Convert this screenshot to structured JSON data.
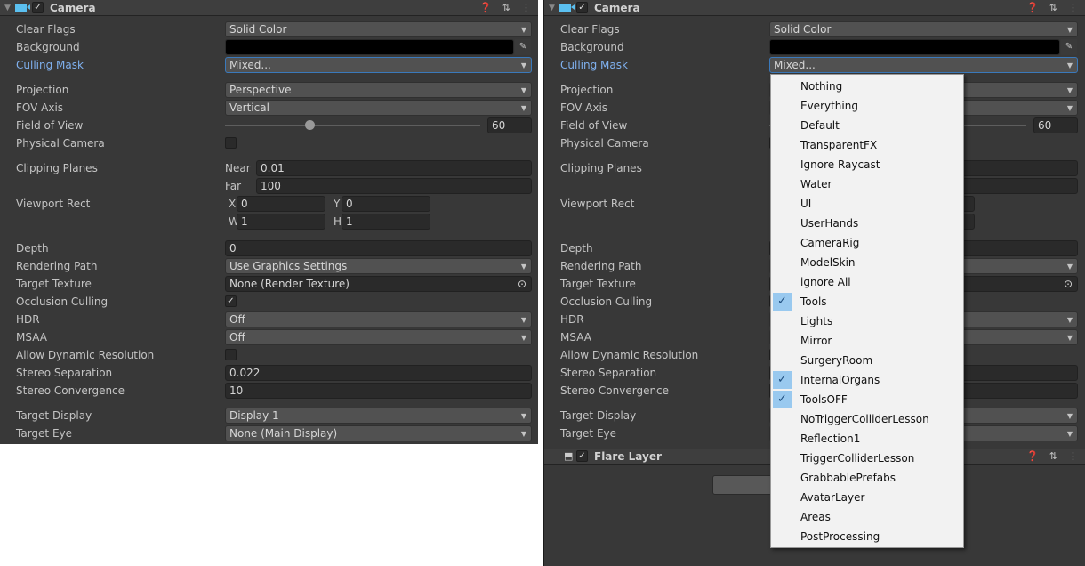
{
  "component": {
    "title": "Camera",
    "icons": {
      "help": "help-icon",
      "presets": "sliders-icon",
      "menu": "kebab-menu-icon"
    }
  },
  "fields": {
    "clear_flags": {
      "label": "Clear Flags",
      "value": "Solid Color"
    },
    "background": {
      "label": "Background",
      "color": "#000000"
    },
    "culling_mask": {
      "label": "Culling Mask",
      "value": "Mixed..."
    },
    "projection": {
      "label": "Projection",
      "value": "Perspective"
    },
    "fov_axis": {
      "label": "FOV Axis",
      "value": "Vertical"
    },
    "field_of_view": {
      "label": "Field of View",
      "value": "60",
      "slider_min": 1,
      "slider_max": 179
    },
    "physical_camera": {
      "label": "Physical Camera",
      "checked": false
    },
    "clipping_planes": {
      "label": "Clipping Planes",
      "near_label": "Near",
      "near": "0.01",
      "far_label": "Far",
      "far": "100"
    },
    "viewport_rect": {
      "label": "Viewport Rect",
      "x_label": "X",
      "x": "0",
      "y_label": "Y",
      "y": "0",
      "w_label": "W",
      "w": "1",
      "h_label": "H",
      "h": "1"
    },
    "depth": {
      "label": "Depth",
      "value": "0"
    },
    "rendering_path": {
      "label": "Rendering Path",
      "value": "Use Graphics Settings"
    },
    "target_texture": {
      "label": "Target Texture",
      "value": "None (Render Texture)"
    },
    "occlusion_culling": {
      "label": "Occlusion Culling",
      "checked": true
    },
    "hdr": {
      "label": "HDR",
      "value": "Off"
    },
    "msaa": {
      "label": "MSAA",
      "value": "Off"
    },
    "allow_dynamic_resolution": {
      "label": "Allow Dynamic Resolution",
      "checked": false
    },
    "stereo_separation": {
      "label": "Stereo Separation",
      "value": "0.022"
    },
    "stereo_convergence": {
      "label": "Stereo Convergence",
      "value": "10"
    },
    "target_display": {
      "label": "Target Display",
      "value": "Display 1"
    },
    "target_eye": {
      "label": "Target Eye",
      "value": "None (Main Display)"
    }
  },
  "culling_mask_menu": {
    "items": [
      {
        "label": "Nothing",
        "checked": false
      },
      {
        "label": "Everything",
        "checked": false
      },
      {
        "label": "Default",
        "checked": false
      },
      {
        "label": "TransparentFX",
        "checked": false
      },
      {
        "label": "Ignore Raycast",
        "checked": false
      },
      {
        "label": "Water",
        "checked": false
      },
      {
        "label": "UI",
        "checked": false
      },
      {
        "label": "UserHands",
        "checked": false
      },
      {
        "label": "CameraRig",
        "checked": false
      },
      {
        "label": "ModelSkin",
        "checked": false
      },
      {
        "label": "ignore All",
        "checked": false
      },
      {
        "label": "Tools",
        "checked": true
      },
      {
        "label": "Lights",
        "checked": false
      },
      {
        "label": "Mirror",
        "checked": false
      },
      {
        "label": "SurgeryRoom",
        "checked": false
      },
      {
        "label": "InternalOrgans",
        "checked": true
      },
      {
        "label": "ToolsOFF",
        "checked": true
      },
      {
        "label": "NoTriggerColliderLesson",
        "checked": false
      },
      {
        "label": "Reflection1",
        "checked": false
      },
      {
        "label": "TriggerColliderLesson",
        "checked": false
      },
      {
        "label": "GrabbablePrefabs",
        "checked": false
      },
      {
        "label": "AvatarLayer",
        "checked": false
      },
      {
        "label": "Areas",
        "checked": false
      },
      {
        "label": "PostProcessing",
        "checked": false
      }
    ]
  },
  "flare_layer": {
    "title": "Flare Layer"
  },
  "colors": {
    "panel": "#383838",
    "accent_label": "#7fb0ee",
    "checked_highlight": "#99c9ef"
  }
}
